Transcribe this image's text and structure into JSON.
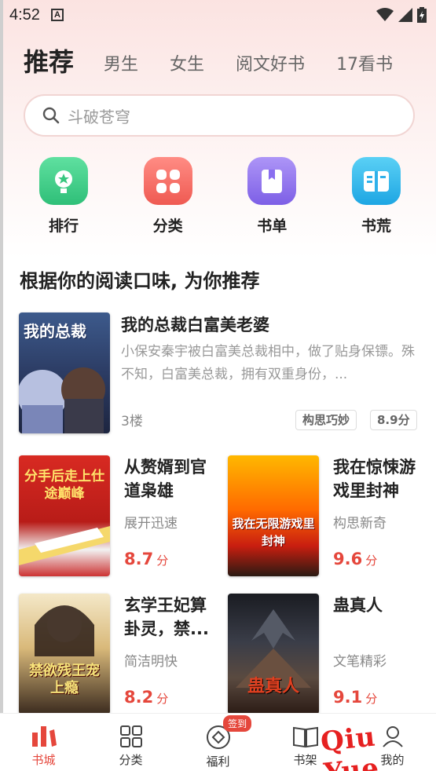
{
  "status_bar": {
    "time": "4:52"
  },
  "tabs": [
    {
      "label": "推荐",
      "active": true
    },
    {
      "label": "男生"
    },
    {
      "label": "女生"
    },
    {
      "label": "阅文好书"
    },
    {
      "label": "17看书"
    }
  ],
  "search": {
    "placeholder": "斗破苍穹"
  },
  "quick_links": [
    {
      "label": "排行",
      "icon": "trophy-icon",
      "color": "#3fcf88"
    },
    {
      "label": "分类",
      "icon": "grid-icon",
      "color": "#f26a63"
    },
    {
      "label": "书单",
      "icon": "booklist-icon",
      "color": "#8f72ee"
    },
    {
      "label": "书荒",
      "icon": "open-book-icon",
      "color": "#2fb6ea"
    }
  ],
  "section_title": "根据你的阅读口味, 为你推荐",
  "featured": {
    "title": "我的总裁白富美老婆",
    "description": "小保安秦宇被白富美总裁相中，做了贴身保镖。殊不知，白富美总裁，拥有双重身份，...",
    "meta": "3楼",
    "tags": [
      "构思巧妙",
      "8.9分"
    ],
    "cover_text": "我的总裁"
  },
  "books": [
    {
      "title": "从赘婿到官道枭雄",
      "subtitle": "展开迅速",
      "score": "8.7",
      "unit": "分",
      "cover_text": "分手后走上仕途巅峰"
    },
    {
      "title": "我在惊悚游戏里封神",
      "subtitle": "构思新奇",
      "score": "9.6",
      "unit": "分",
      "cover_text": "我在无限游戏里封神"
    },
    {
      "title": "玄学王妃算卦灵，禁...",
      "subtitle": "简洁明快",
      "score": "8.2",
      "unit": "分",
      "cover_text": "禁欲残王宠上瘾"
    },
    {
      "title": "蛊真人",
      "subtitle": "文笔精彩",
      "score": "9.1",
      "unit": "分",
      "cover_text": "蛊真人"
    }
  ],
  "bottom_nav": [
    {
      "label": "书城",
      "icon": "bookstore-icon",
      "active": true
    },
    {
      "label": "分类",
      "icon": "category-grid-icon"
    },
    {
      "label": "福利",
      "icon": "welfare-icon",
      "badge": "签到"
    },
    {
      "label": "书架",
      "icon": "bookshelf-icon"
    },
    {
      "label": "我的",
      "icon": "profile-icon"
    }
  ],
  "watermark": "Qiu Yue",
  "colors": {
    "accent": "#e5473c",
    "tab_inactive": "#666666"
  }
}
